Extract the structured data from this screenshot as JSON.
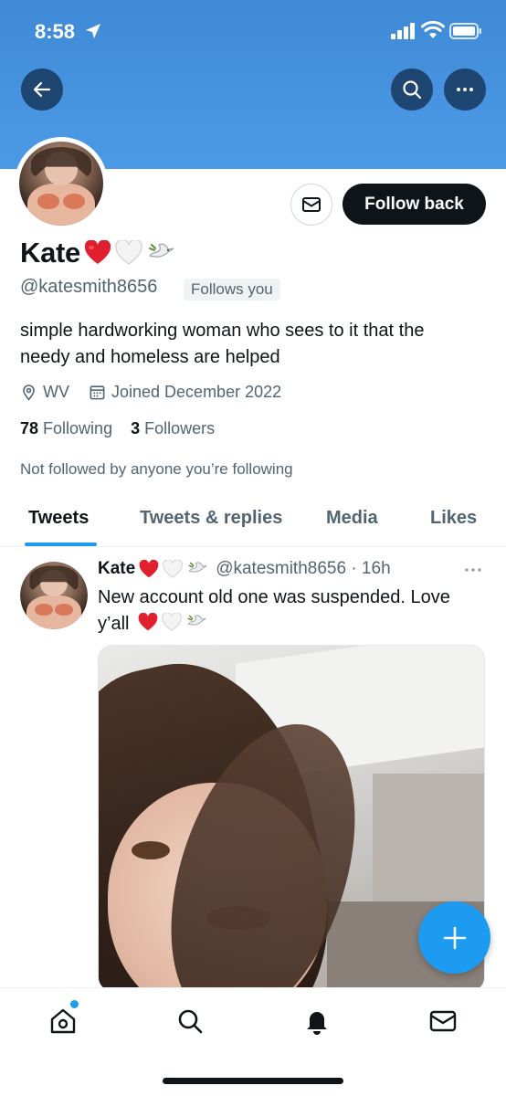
{
  "status_bar": {
    "time": "8:58"
  },
  "profile": {
    "name": "Kate",
    "name_emojis": [
      "red-heart",
      "white-heart",
      "dove"
    ],
    "handle": "@katesmith8656",
    "follows_you": "Follows you",
    "bio": "simple hardworking woman who sees to it that the needy and homeless are helped",
    "location": "WV",
    "joined": "Joined December 2022",
    "following_count": "78",
    "following_label": "Following",
    "followers_count": "3",
    "followers_label": "Followers",
    "not_followed": "Not followed by anyone you’re following",
    "follow_button": "Follow back"
  },
  "tabs": [
    {
      "label": "Tweets",
      "active": true
    },
    {
      "label": "Tweets & replies",
      "active": false
    },
    {
      "label": "Media",
      "active": false
    },
    {
      "label": "Likes",
      "active": false
    }
  ],
  "tweet": {
    "name": "Kate",
    "handle_time": "@katesmith8656 · 16h",
    "text": "New account old one was suspended. Love y’all"
  },
  "colors": {
    "banner": "#4a96e2",
    "accent": "#1d9bf0",
    "text": "#0f1419",
    "secondary_text": "#536471"
  },
  "icons": {
    "back": "arrow-left-icon",
    "search": "search-icon",
    "more": "more-icon",
    "message": "envelope-icon",
    "location": "location-pin-icon",
    "calendar": "calendar-icon",
    "fab": "plus-icon",
    "nav": [
      "home-icon",
      "search-icon",
      "bell-icon",
      "envelope-icon"
    ]
  }
}
